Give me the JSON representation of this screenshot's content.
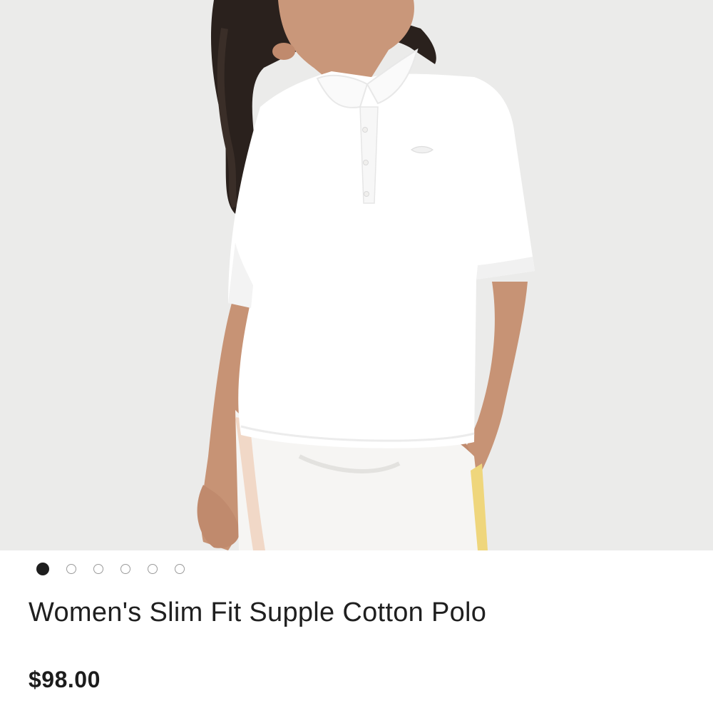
{
  "product": {
    "image": {
      "alt_description": "Model wearing a white slim fit half-sleeve polo shirt",
      "carousel_count": 6,
      "active_index": 0
    },
    "title": "Women's Slim Fit Supple Cotton Polo",
    "price": "$98.00"
  },
  "colors": {
    "background": "#ececec",
    "dot_active": "#1e1e1e",
    "dot_inactive": "#9a9a9a",
    "text": "#1f1f1f"
  }
}
